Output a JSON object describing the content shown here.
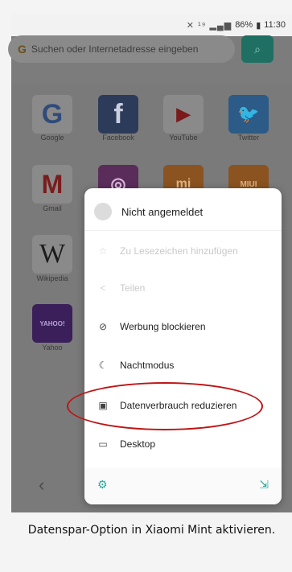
{
  "statusbar": {
    "icons": "✕ ¹⁹ ▂▄▆",
    "battery": "86%",
    "time": "11:30"
  },
  "search": {
    "placeholder": "Suchen oder Internetadresse eingeben"
  },
  "shortcuts": [
    {
      "label": "Google",
      "glyph": "G"
    },
    {
      "label": "Facebook",
      "glyph": "f"
    },
    {
      "label": "YouTube",
      "glyph": "▶"
    },
    {
      "label": "Twitter",
      "glyph": "🐦"
    },
    {
      "label": "Gmail",
      "glyph": "M"
    },
    {
      "label": "",
      "glyph": "◎"
    },
    {
      "label": "",
      "glyph": "mi"
    },
    {
      "label": "",
      "glyph": "MIUI"
    },
    {
      "label": "Wikipedia",
      "glyph": "W"
    },
    {
      "label": "Yahoo",
      "glyph": "YAHOO!"
    }
  ],
  "menu": {
    "account": "Nicht angemeldet",
    "items": [
      {
        "label": "Zu Lesezeichen hinzufügen",
        "icon": "☆",
        "disabled": true
      },
      {
        "label": "Teilen",
        "icon": "<",
        "disabled": true
      },
      {
        "label": "Werbung blockieren",
        "icon": "⊘",
        "disabled": false
      },
      {
        "label": "Nachtmodus",
        "icon": "☾",
        "disabled": false
      },
      {
        "label": "Datenverbrauch reduzieren",
        "icon": "▣",
        "disabled": false
      },
      {
        "label": "Desktop",
        "icon": "▭",
        "disabled": false
      }
    ]
  },
  "caption": "Datenspar-Option in Xiaomi Mint aktivieren."
}
